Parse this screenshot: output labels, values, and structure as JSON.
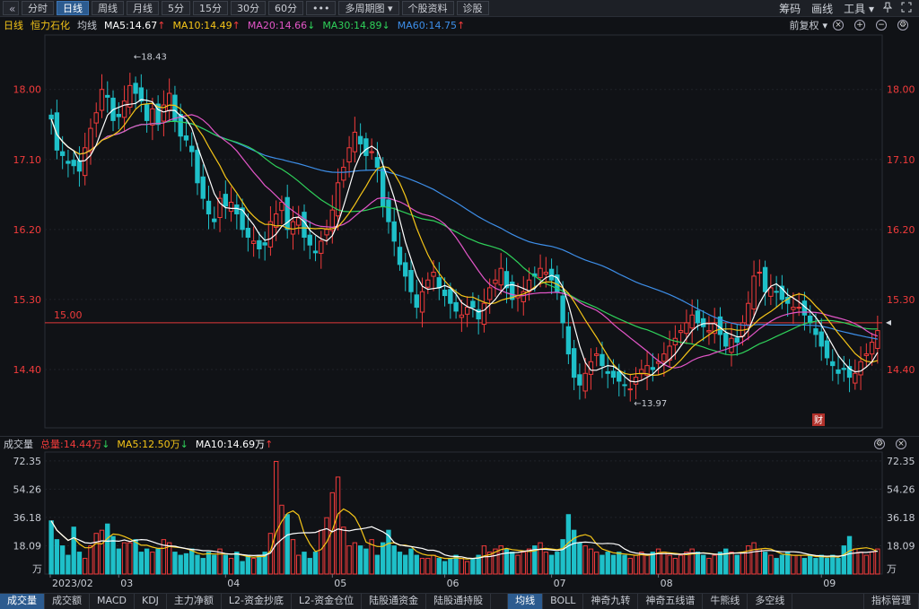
{
  "toolbar": {
    "back_icon": "«",
    "tabs": [
      {
        "label": "分时",
        "active": false
      },
      {
        "label": "日线",
        "active": true
      },
      {
        "label": "周线",
        "active": false
      },
      {
        "label": "月线",
        "active": false
      },
      {
        "label": "5分",
        "active": false
      },
      {
        "label": "15分",
        "active": false
      },
      {
        "label": "30分",
        "active": false
      },
      {
        "label": "60分",
        "active": false
      },
      {
        "label": "•••",
        "active": false
      },
      {
        "label": "多周期图 ▾",
        "active": false
      },
      {
        "label": "个股资料",
        "active": false
      },
      {
        "label": "诊股",
        "active": false
      }
    ],
    "right": {
      "chips": "筹码",
      "draw": "画线",
      "tools": "工具 ▾",
      "pin_icon": "pin-icon",
      "expand_icon": "expand-icon"
    }
  },
  "ma_header": {
    "period": "日线",
    "name": "恒力石化",
    "ma_label": "均线",
    "ma5": "MA5:14.67",
    "ma10": "MA10:14.49",
    "ma20": "MA20:14.66",
    "ma30": "MA30:14.89",
    "ma60": "MA60:14.75",
    "right_label": "前复权"
  },
  "volume_header": {
    "title": "成交量",
    "total": "总量:14.44万",
    "ma5": "MA5:12.50万",
    "ma10": "MA10:14.69万"
  },
  "colors": {
    "up": "#f23b3b",
    "down": "#1ec0c9",
    "ma5": "#ffffff",
    "ma10": "#f5c518",
    "ma20": "#e356c8",
    "ma30": "#2fd15a",
    "ma60": "#3d8ee8",
    "ref": "#e03a3a"
  },
  "chart_data": [
    {
      "type": "candlestick",
      "y_ticks": [
        "18.00",
        "17.10",
        "16.20",
        "15.30",
        "14.40"
      ],
      "y_values": [
        18.0,
        17.1,
        16.2,
        15.3,
        14.4
      ],
      "ylim": [
        13.65,
        18.7
      ],
      "ref_line": {
        "value": 15.0,
        "label": "15.00"
      },
      "annotations": [
        {
          "text": "18.43",
          "value": 18.43
        },
        {
          "text": "13.97",
          "value": 13.97
        }
      ],
      "badge": "财",
      "x_labels": [
        "03",
        "04",
        "05",
        "06",
        "07",
        "08",
        "09"
      ],
      "closes": [
        17.62,
        17.22,
        17.15,
        17.05,
        17.02,
        16.95,
        17.25,
        17.5,
        17.7,
        18.0,
        17.9,
        17.6,
        17.65,
        17.85,
        18.05,
        17.95,
        17.85,
        17.6,
        17.75,
        17.55,
        17.8,
        17.95,
        17.6,
        17.4,
        17.35,
        17.2,
        16.8,
        16.6,
        16.4,
        16.3,
        16.6,
        16.5,
        16.55,
        16.4,
        16.2,
        16.1,
        16.05,
        15.95,
        16.0,
        16.3,
        16.4,
        16.55,
        16.2,
        16.3,
        16.35,
        16.1,
        16.0,
        15.9,
        16.05,
        16.2,
        16.45,
        16.8,
        17.0,
        17.25,
        17.45,
        17.3,
        17.15,
        17.2,
        17.0,
        16.5,
        16.3,
        16.05,
        15.75,
        15.6,
        15.4,
        15.2,
        15.4,
        15.55,
        15.65,
        15.45,
        15.35,
        15.25,
        15.15,
        15.1,
        15.2,
        15.2,
        15.05,
        15.25,
        15.45,
        15.55,
        15.7,
        15.45,
        15.3,
        15.35,
        15.4,
        15.55,
        15.6,
        15.7,
        15.65,
        15.55,
        15.4,
        15.0,
        14.6,
        14.3,
        14.2,
        14.35,
        14.5,
        14.6,
        14.45,
        14.35,
        14.3,
        14.25,
        14.2,
        14.15,
        14.3,
        14.4,
        14.45,
        14.4,
        14.5,
        14.6,
        14.7,
        14.8,
        14.9,
        15.0,
        15.1,
        15.0,
        14.95,
        14.9,
        15.0,
        14.85,
        14.7,
        14.8,
        14.75,
        15.0,
        15.25,
        15.6,
        15.65,
        15.4,
        15.45,
        15.4,
        15.3,
        15.25,
        15.2,
        15.2,
        15.1,
        15.0,
        14.85,
        14.7,
        14.55,
        14.45,
        14.35,
        14.4,
        14.3,
        14.35,
        14.5,
        14.6,
        14.75,
        14.9
      ],
      "volumes": [
        34.0,
        22.0,
        18.0,
        12.0,
        30.0,
        14.0,
        10.0,
        18.0,
        26.0,
        28.0,
        32.0,
        24.0,
        16.0,
        20.0,
        20.0,
        22.0,
        14.0,
        16.0,
        14.0,
        16.0,
        22.0,
        20.0,
        14.0,
        12.0,
        13.0,
        16.0,
        12.0,
        10.0,
        14.0,
        12.0,
        16.0,
        12.0,
        10.0,
        14.0,
        8.0,
        12.0,
        10.0,
        12.0,
        14.0,
        26.0,
        72.0,
        44.0,
        38.0,
        22.0,
        12.0,
        14.0,
        10.0,
        14.0,
        28.0,
        36.0,
        52.0,
        62.0,
        30.0,
        18.0,
        20.0,
        18.0,
        16.0,
        22.0,
        12.0,
        20.0,
        28.0,
        18.0,
        14.0,
        12.0,
        16.0,
        12.0,
        10.0,
        10.0,
        12.0,
        10.0,
        8.0,
        10.0,
        12.0,
        10.0,
        8.0,
        10.0,
        12.0,
        18.0,
        14.0,
        16.0,
        18.0,
        16.0,
        14.0,
        12.0,
        14.0,
        16.0,
        18.0,
        20.0,
        14.0,
        12.0,
        14.0,
        22.0,
        38.0,
        28.0,
        20.0,
        18.0,
        16.0,
        14.0,
        12.0,
        14.0,
        12.0,
        14.0,
        12.0,
        10.0,
        12.0,
        14.0,
        12.0,
        14.0,
        16.0,
        14.0,
        12.0,
        10.0,
        12.0,
        14.0,
        16.0,
        14.0,
        12.0,
        10.0,
        12.0,
        14.0,
        16.0,
        14.0,
        12.0,
        14.0,
        18.0,
        20.0,
        16.0,
        14.0,
        12.0,
        10.0,
        12.0,
        14.0,
        12.0,
        12.0,
        10.0,
        12.0,
        10.0,
        12.0,
        10.0,
        12.0,
        10.0,
        18.0,
        24.0,
        16.0,
        14.0,
        12.0,
        14.0,
        16.0
      ]
    },
    {
      "type": "bar",
      "title": "成交量",
      "y_ticks": [
        "72.35",
        "54.26",
        "36.18",
        "18.09"
      ],
      "y_values": [
        72.35,
        54.26,
        36.18,
        18.09
      ],
      "unit": "万",
      "x_labels": [
        "2023/02",
        "03",
        "04",
        "05",
        "06",
        "07",
        "08",
        "09"
      ]
    }
  ],
  "bottom_tabs": [
    "成交量",
    "成交额",
    "MACD",
    "KDJ",
    "主力净额",
    "L2-资金抄底",
    "L2-资金仓位",
    "陆股通资金",
    "陆股通持股",
    "均线",
    "BOLL",
    "神奇九转",
    "神奇五线谱",
    "牛熊线",
    "多空线"
  ],
  "bottom_active": [
    "成交量",
    "均线"
  ],
  "bottom_right": "指标管理"
}
